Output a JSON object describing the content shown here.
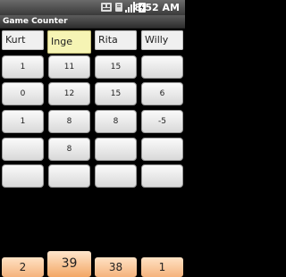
{
  "status": {
    "time": "8:52 AM"
  },
  "app": {
    "title": "Game Counter"
  },
  "players": [
    {
      "name": "Kurt",
      "total": "2"
    },
    {
      "name": "Inge",
      "total": "39"
    },
    {
      "name": "Rita",
      "total": "38"
    },
    {
      "name": "Willy",
      "total": "1"
    }
  ],
  "rows": [
    [
      "1",
      "11",
      "15",
      ""
    ],
    [
      "0",
      "12",
      "15",
      "6"
    ],
    [
      "1",
      "8",
      "8",
      "-5"
    ],
    [
      "",
      "8",
      "",
      ""
    ],
    [
      "",
      "",
      "",
      ""
    ]
  ],
  "colors": {
    "active_name": "#f6f4b4",
    "total_bar": "#f5b37d"
  }
}
